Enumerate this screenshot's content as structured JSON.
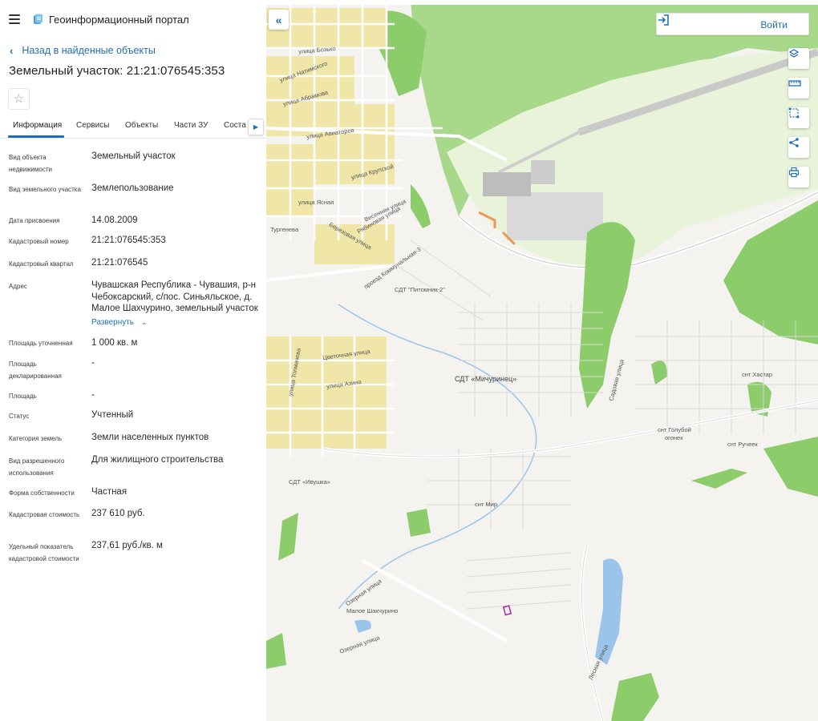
{
  "app": {
    "title": "Геоинформационный портал"
  },
  "panel": {
    "back_label": "Назад в найденные объекты",
    "object_title": "Земельный участок: 21:21:076545:353",
    "tabs": [
      {
        "label": "Информация",
        "active": true
      },
      {
        "label": "Сервисы"
      },
      {
        "label": "Объекты"
      },
      {
        "label": "Части ЗУ"
      },
      {
        "label": "Соста"
      }
    ],
    "properties": [
      {
        "label": "Вид объекта недвижимости",
        "value": "Земельный участок"
      },
      {
        "label": "Вид земельного участка",
        "value": "Землепользование"
      },
      {
        "label": "Дата присвоения",
        "value": "14.08.2009"
      },
      {
        "label": "Кадастровый номер",
        "value": "21:21:076545:353"
      },
      {
        "label": "Кадастровый квартал",
        "value": "21:21:076545"
      },
      {
        "label": "Адрес",
        "value": "Чувашская Республика - Чувашия, р-н Чебоксарский, с/пос. Синьяльское, д. Малое Шахчурино, земельный участок"
      },
      {
        "label": "Площадь уточненная",
        "value": "1 000 кв. м"
      },
      {
        "label": "Площадь декларированная",
        "value": "-"
      },
      {
        "label": "Площадь",
        "value": "-"
      },
      {
        "label": "Статус",
        "value": "Учтенный"
      },
      {
        "label": "Категория земель",
        "value": "Земли населенных пунктов"
      },
      {
        "label": "Вид разрешенного использования",
        "value": "Для жилищного строительства"
      },
      {
        "label": "Форма собственности",
        "value": "Частная"
      },
      {
        "label": "Кадастровая стоимость",
        "value": "237 610 руб."
      },
      {
        "label": "Удельный показатель кадастровой стоимости",
        "value": "237,61 руб./кв. м"
      }
    ],
    "expand_label": "Развернуть"
  },
  "map": {
    "login_label": "Войти",
    "labels": {
      "sdt_michurinets": "СДТ «Мичуринец»",
      "sdt_pitomnik": "СДТ \"Питомник-2\"",
      "sdt_ivushka": "СДТ «Ивушка»",
      "snt_mir": "снт Мир",
      "snt_khastar": "снт Хастар",
      "snt_goluboy": "снт Голубой",
      "snt_goluboy_2": "огонек",
      "snt_ruchek": "снт Ручеек",
      "maloe_shakhchurino": "Малое Шахчурино",
      "ul_aviatorov": "улица Авиаторов",
      "ul_sadovaya": "Садовая улица",
      "ul_tsvetochnaya": "Цветочная улица",
      "ul_ozernaya": "Озерная улица",
      "ul_ozernaya_2": "Озерная улица",
      "ul_lesnaya": "Лесная улица",
      "ul_yasnaya": "улица Ясная",
      "ul_krupskoy": "улица Крупской",
      "ul_berezovaya": "Березовая улица",
      "ul_ryabinovaya": "Рябиновая улица",
      "ul_vesennyaya": "Весенняя улица",
      "ul_azina": "улица Азина",
      "ul_tolmacheva": "улица Толмачева",
      "ul_turgeneva": "Тургенева",
      "ul_natimskogo": "улица Натимского",
      "ul_bozhko": "улица Бозько",
      "ul_abramova": "улица Абрамова",
      "proezd_kommunalnaya": "проезд Коммунальная-3"
    }
  },
  "colors": {
    "accent": "#1f6fb5",
    "forest": "#8dcc6a",
    "airport": "#e6f3d8",
    "water": "#9cc4ea",
    "parcel": "#b0209e"
  },
  "icons": {
    "menu": "hamburger-icon",
    "logo": "portal-logo-icon",
    "back": "chevron-left-icon",
    "favorite": "star-icon",
    "tab_scroll": "chevron-right-icon",
    "expand": "chevron-down-icon",
    "collapse": "double-chevron-left-icon",
    "login": "sign-in-icon",
    "layers": "layers-icon",
    "measure": "ruler-icon",
    "select": "area-select-icon",
    "share": "share-icon",
    "print": "printer-icon"
  }
}
